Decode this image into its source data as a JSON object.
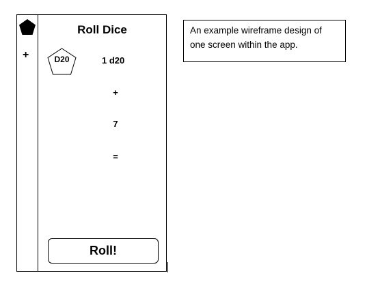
{
  "screen": {
    "title": "Roll Dice",
    "rail": {
      "top_icon": "pentagon-icon",
      "add_symbol": "+"
    },
    "die": {
      "icon": "pentagon-outline-icon",
      "label": "D20"
    },
    "expression": {
      "dice": "1 d20",
      "plus": "+",
      "modifier": "7",
      "equals": "="
    },
    "roll_button": "Roll!"
  },
  "note": {
    "text": "An example wireframe design of one screen within the app."
  }
}
